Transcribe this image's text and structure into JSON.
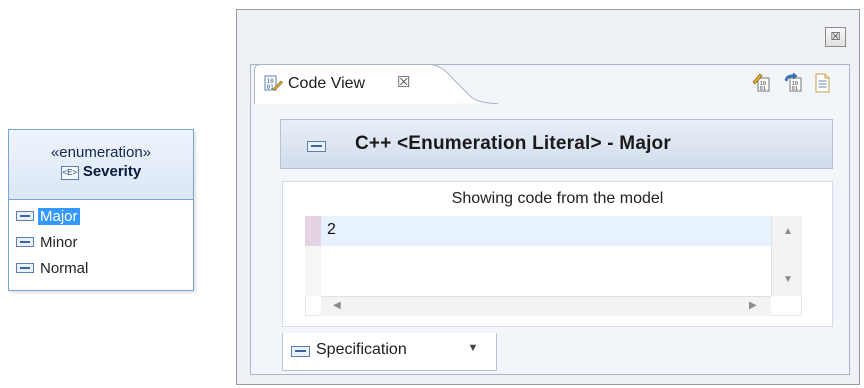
{
  "uml_class": {
    "stereotype": "«enumeration»",
    "icon_text": "<E>",
    "name": "Severity",
    "literals": [
      "Major",
      "Minor",
      "Normal"
    ],
    "selected_literal": "Major"
  },
  "view": {
    "tab_label": "Code View",
    "tab_close_glyph": "☒",
    "window_close_glyph": "☒",
    "toolbar_icons": [
      "generate-code-icon",
      "synchronize-icon",
      "document-icon"
    ],
    "header_title": "C++ <Enumeration Literal> - Major",
    "code_caption": "Showing code from the model",
    "code_lines": [
      "2"
    ],
    "bottom_tab_label": "Specification",
    "bottom_tab_dropdown": "▼"
  },
  "colors": {
    "selection": "#3399ff",
    "uml_border": "#7aa3d6",
    "header_gradient_top": "#e7eef7",
    "header_gradient_bottom": "#d2ddea"
  }
}
